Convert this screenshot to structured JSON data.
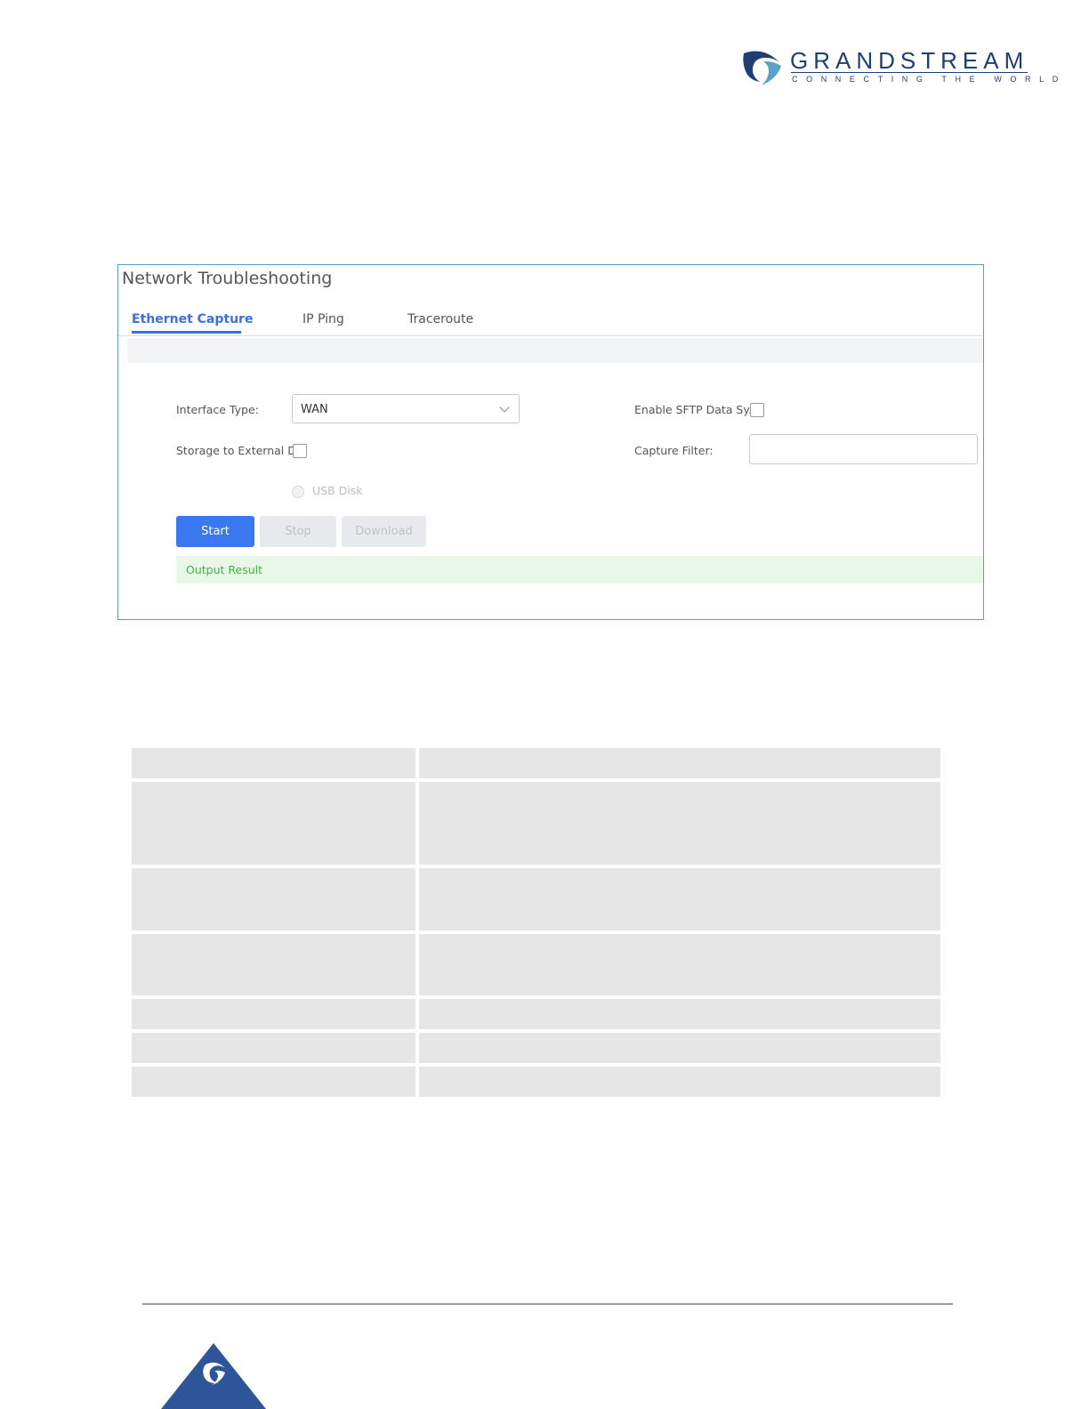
{
  "header": {
    "brand": "GRANDSTREAM",
    "tagline": "CONNECTING THE WORLD",
    "brand_color": "#1f3f73",
    "logo_icon": "grandstream-logo-icon"
  },
  "panel": {
    "title": "Network Troubleshooting",
    "tabs": [
      {
        "label": "Ethernet Capture",
        "active": true
      },
      {
        "label": "IP Ping",
        "active": false
      },
      {
        "label": "Traceroute",
        "active": false
      }
    ],
    "accent_color": "#3a6fe6",
    "form": {
      "interface_type_label": "Interface Type:",
      "interface_type_value": "WAN",
      "storage_label": "Storage to External D..",
      "storage_checked": false,
      "usb_disk_label": "USB Disk",
      "enable_sftp_label": "Enable SFTP Data Sy...",
      "enable_sftp_checked": false,
      "capture_filter_label": "Capture Filter:",
      "capture_filter_value": ""
    },
    "buttons": {
      "start": "Start",
      "stop": "Stop",
      "download": "Download"
    },
    "output_result": "Output Result"
  },
  "table": {
    "rows": 7,
    "cell_color": "#e6e6e6"
  }
}
